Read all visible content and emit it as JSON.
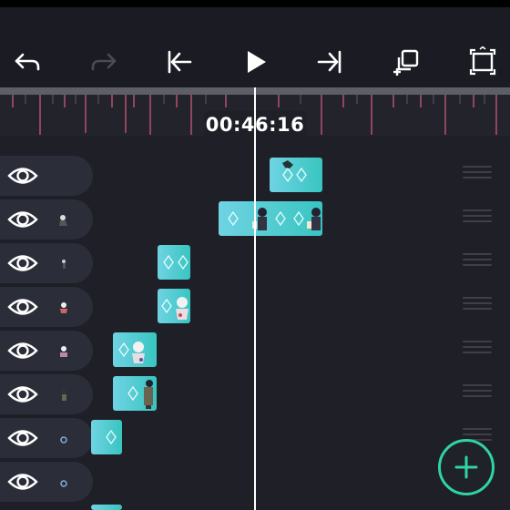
{
  "toolbar": {
    "undo_icon": "undo-icon",
    "redo_icon": "redo-icon",
    "skip_start_icon": "skip-to-start-icon",
    "play_icon": "play-icon",
    "skip_end_icon": "skip-to-end-icon",
    "duplicate_icon": "duplicate-layer-icon",
    "fullscreen_icon": "fullscreen-icon"
  },
  "timeline": {
    "timecode": "00:46:16"
  },
  "tracks": [
    {
      "visible": true
    },
    {
      "visible": true
    },
    {
      "visible": true
    },
    {
      "visible": true
    },
    {
      "visible": true
    },
    {
      "visible": true
    },
    {
      "visible": true
    },
    {
      "visible": true
    }
  ],
  "colors": {
    "background": "#1e1f27",
    "track_header": "#2b2d38",
    "clip": "#4fcfd2",
    "accent": "#2fd3a6",
    "ruler_tick": "#c05574"
  },
  "fab": {
    "icon": "plus-icon"
  }
}
